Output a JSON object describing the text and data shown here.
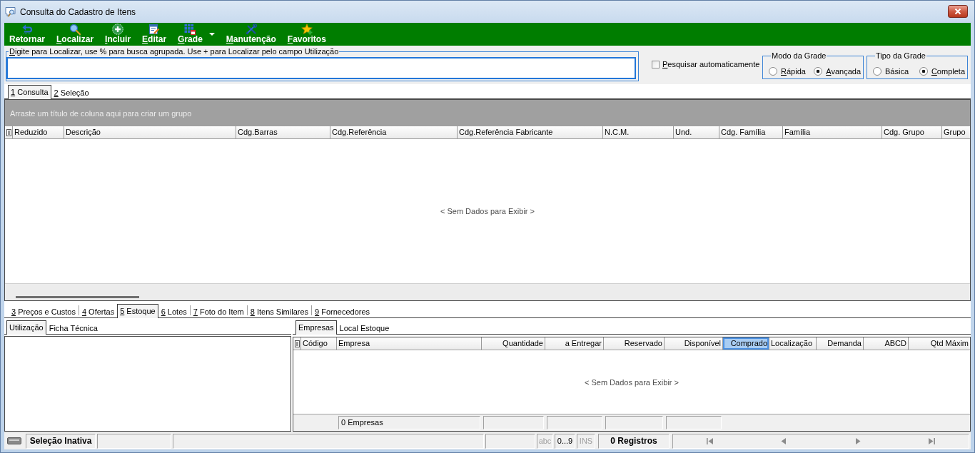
{
  "window": {
    "title": "Consulta do Cadastro de Itens"
  },
  "toolbar": [
    {
      "label": "Retornar",
      "mnemonic": false,
      "has_menu": false
    },
    {
      "label": "Localizar",
      "mnemonic": true,
      "has_menu": false
    },
    {
      "label": "Incluir",
      "mnemonic": true,
      "has_menu": false
    },
    {
      "label": "Editar",
      "mnemonic": true,
      "has_menu": false
    },
    {
      "label": "Grade",
      "mnemonic": true,
      "has_menu": true
    },
    {
      "label": "Manutenção",
      "mnemonic": true,
      "has_menu": false
    },
    {
      "label": "Favoritos",
      "mnemonic": true,
      "has_menu": false
    }
  ],
  "search": {
    "label": "Digite para Localizar, use % para busca agrupada. Use + para Localizar pelo campo Utilização",
    "mnemonic": true
  },
  "auto_search": {
    "label": "Pesquisar automaticamente",
    "mnemonic": true,
    "checked": false
  },
  "grid_mode": {
    "title": "Modo da Grade",
    "options": [
      {
        "label": "Rápida",
        "mnemonic": true,
        "selected": false
      },
      {
        "label": "Avançada",
        "mnemonic": true,
        "selected": true
      }
    ]
  },
  "grid_type": {
    "title": "Tipo da Grade",
    "options": [
      {
        "label": "Básica",
        "mnemonic": false,
        "selected": false
      },
      {
        "label": "Completa",
        "mnemonic": true,
        "selected": true
      }
    ]
  },
  "main_tabs": [
    {
      "label": "1 Consulta",
      "mnemonic": true,
      "selected": true
    },
    {
      "label": "2 Seleção",
      "mnemonic": true,
      "selected": false
    }
  ],
  "main_grid": {
    "group_panel": "Arraste um título de coluna aqui para criar um grupo",
    "columns": [
      {
        "label": "Reduzido"
      },
      {
        "label": "Descrição"
      },
      {
        "label": "Cdg.Barras"
      },
      {
        "label": "Cdg.Referência"
      },
      {
        "label": "Cdg.Referência Fabricante"
      },
      {
        "label": "N.C.M."
      },
      {
        "label": "Und."
      },
      {
        "label": "Cdg. Família"
      },
      {
        "label": "Família"
      },
      {
        "label": "Cdg. Grupo"
      },
      {
        "label": "Grupo"
      }
    ],
    "empty_text": "< Sem Dados para Exibir >"
  },
  "detail_tabs": [
    {
      "label": "3 Preços e Custos",
      "mnemonic": true,
      "selected": false
    },
    {
      "label": "4 Ofertas",
      "mnemonic": true,
      "selected": false
    },
    {
      "label": "5 Estoque",
      "mnemonic": true,
      "selected": true
    },
    {
      "label": "6 Lotes",
      "mnemonic": true,
      "selected": false
    },
    {
      "label": "7 Foto do Item",
      "mnemonic": true,
      "selected": false
    },
    {
      "label": "8 Itens Similares",
      "mnemonic": true,
      "selected": false
    },
    {
      "label": "9 Fornecedores",
      "mnemonic": true,
      "selected": false
    }
  ],
  "left_panel": {
    "tabs": [
      {
        "label": "Utilização",
        "selected": true
      },
      {
        "label": "Ficha Técnica",
        "selected": false
      }
    ]
  },
  "right_panel": {
    "tabs": [
      {
        "label": "Empresas",
        "selected": true
      },
      {
        "label": "Local Estoque",
        "selected": false
      }
    ],
    "grid": {
      "columns": [
        {
          "label": "Código",
          "numeric": false,
          "highlighted": false,
          "has_summary": false
        },
        {
          "label": "Empresa",
          "numeric": false,
          "highlighted": false,
          "has_summary": true,
          "summary": "0 Empresas"
        },
        {
          "label": "Quantidade",
          "numeric": true,
          "highlighted": false,
          "has_summary": true
        },
        {
          "label": "a Entregar",
          "numeric": true,
          "highlighted": false,
          "has_summary": true
        },
        {
          "label": "Reservado",
          "numeric": true,
          "highlighted": false,
          "has_summary": true
        },
        {
          "label": "Disponível",
          "numeric": true,
          "highlighted": false,
          "has_summary": true
        },
        {
          "label": "Comprado",
          "numeric": true,
          "highlighted": true,
          "has_summary": false
        },
        {
          "label": "Localização",
          "numeric": false,
          "highlighted": false,
          "has_summary": false
        },
        {
          "label": "Demanda",
          "numeric": true,
          "highlighted": false,
          "has_summary": false
        },
        {
          "label": "ABCD",
          "numeric": true,
          "highlighted": false,
          "has_summary": false
        },
        {
          "label": "Qtd Máxim",
          "numeric": true,
          "highlighted": false,
          "has_summary": false
        }
      ],
      "empty_text": "< Sem Dados para Exibir >"
    }
  },
  "status_bar": {
    "selection": "Seleção Inativa",
    "indicators": [
      {
        "label": "abc",
        "active": false
      },
      {
        "label": "0...9",
        "active": true
      },
      {
        "label": "INS",
        "active": false
      }
    ],
    "records": "0 Registros",
    "navigation_disabled": true
  }
}
